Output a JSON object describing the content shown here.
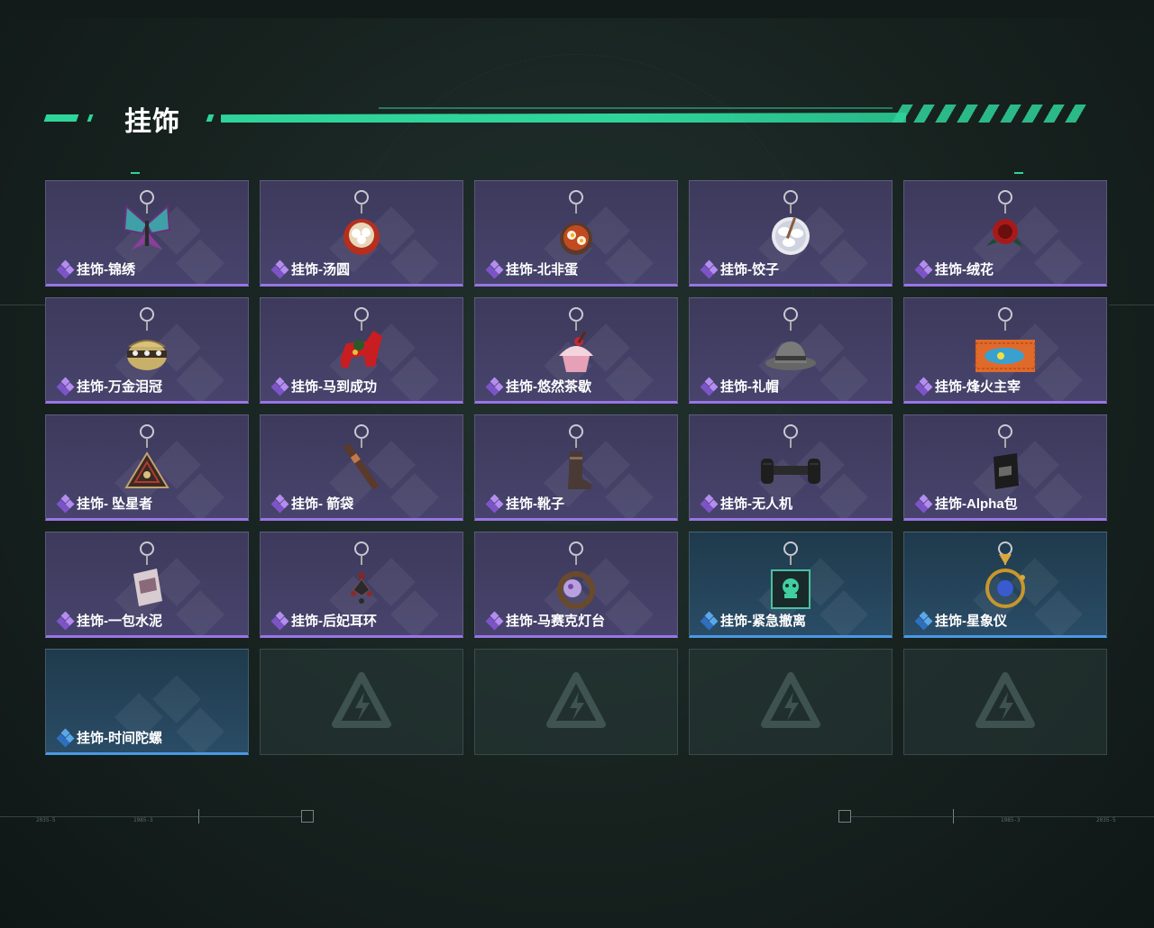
{
  "header": {
    "title": "挂饰"
  },
  "colors": {
    "accent": "#2fd49a",
    "epic": "#9a74e6",
    "rare": "#4a98e4"
  },
  "deco_labels": [
    "2035-5",
    "1985-3"
  ],
  "items": [
    {
      "label": "挂饰-锦绣",
      "rarity": "purple",
      "icon": "butterfly-charm-icon"
    },
    {
      "label": "挂饰-汤圆",
      "rarity": "purple",
      "icon": "tangyuan-bowl-charm-icon"
    },
    {
      "label": "挂饰-北非蛋",
      "rarity": "purple",
      "icon": "shakshuka-charm-icon"
    },
    {
      "label": "挂饰-饺子",
      "rarity": "purple",
      "icon": "dumpling-plate-charm-icon"
    },
    {
      "label": "挂饰-绒花",
      "rarity": "purple",
      "icon": "velvet-flower-charm-icon"
    },
    {
      "label": "挂饰-万金泪冠",
      "rarity": "purple",
      "icon": "crown-charm-icon"
    },
    {
      "label": "挂饰-马到成功",
      "rarity": "purple",
      "icon": "red-horse-charm-icon"
    },
    {
      "label": "挂饰-悠然茶歇",
      "rarity": "purple",
      "icon": "cupcake-charm-icon"
    },
    {
      "label": "挂饰-礼帽",
      "rarity": "purple",
      "icon": "fedora-hat-charm-icon"
    },
    {
      "label": "挂饰-烽火主宰",
      "rarity": "purple",
      "icon": "graffiti-container-charm-icon"
    },
    {
      "label": "挂饰- 坠星者",
      "rarity": "purple",
      "icon": "triangle-pendant-charm-icon"
    },
    {
      "label": "挂饰- 箭袋",
      "rarity": "purple",
      "icon": "quiver-charm-icon"
    },
    {
      "label": "挂饰-靴子",
      "rarity": "purple",
      "icon": "boot-charm-icon"
    },
    {
      "label": "挂饰-无人机",
      "rarity": "purple",
      "icon": "drone-charm-icon"
    },
    {
      "label": "挂饰-Alpha包",
      "rarity": "purple",
      "icon": "alpha-pouch-charm-icon"
    },
    {
      "label": "挂饰-一包水泥",
      "rarity": "purple",
      "icon": "cement-bag-charm-icon"
    },
    {
      "label": "挂饰-后妃耳环",
      "rarity": "purple",
      "icon": "earring-charm-icon"
    },
    {
      "label": "挂饰-马赛克灯台",
      "rarity": "purple",
      "icon": "mosaic-lamp-charm-icon"
    },
    {
      "label": "挂饰-紧急撤离",
      "rarity": "blue",
      "icon": "skull-box-charm-icon"
    },
    {
      "label": "挂饰-星象仪",
      "rarity": "blue",
      "icon": "orrery-charm-icon"
    },
    {
      "label": "挂饰-时间陀螺",
      "rarity": "blue",
      "icon": ""
    }
  ],
  "empty_slot_icon": "delta-logo-icon"
}
